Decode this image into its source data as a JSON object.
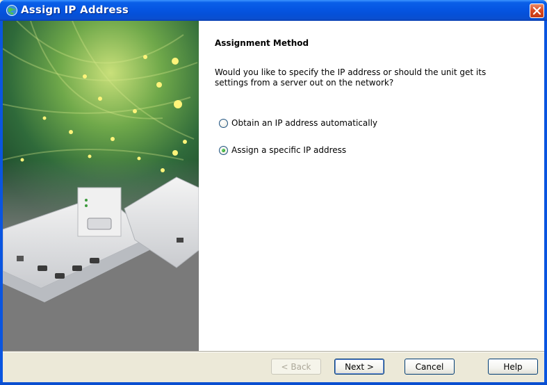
{
  "window": {
    "title": "Assign IP Address",
    "title_icon": "network-globe-icon",
    "close_icon": "close-icon"
  },
  "wizard": {
    "heading": "Assignment Method",
    "question": "Would you like to specify the IP address or should the unit get its settings from a server out on the network?",
    "options": [
      {
        "label": "Obtain an IP address automatically",
        "selected": false
      },
      {
        "label": "Assign a specific IP address",
        "selected": true
      }
    ]
  },
  "buttons": {
    "back": "< Back",
    "next": "Next >",
    "cancel": "Cancel",
    "help": "Help",
    "back_enabled": false
  },
  "colors": {
    "titlebar": "#0555e2",
    "radio_selected": "#2fa42f",
    "dialog_background": "#ece9d8"
  }
}
